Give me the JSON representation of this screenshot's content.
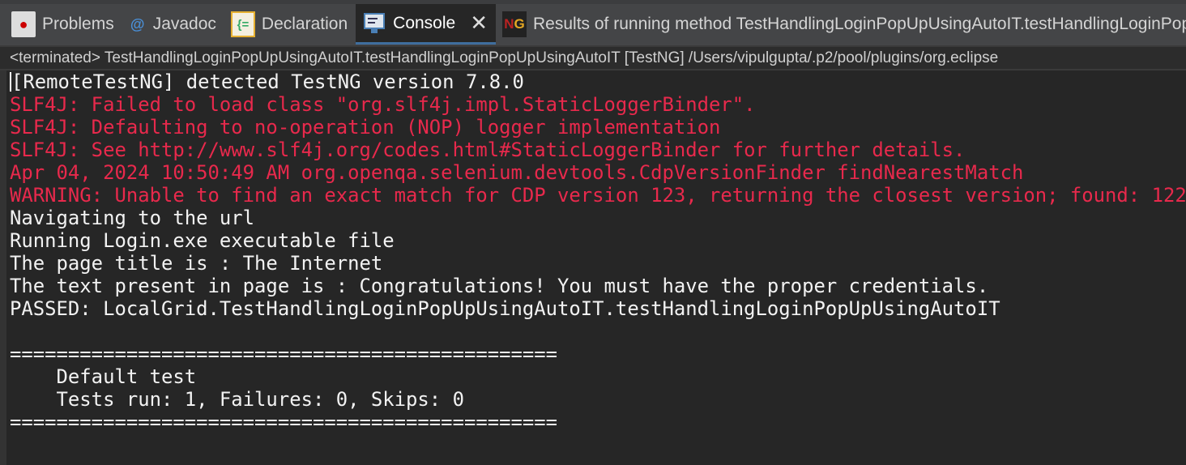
{
  "tabs": [
    {
      "label": "Problems",
      "icon": "problems-icon"
    },
    {
      "label": "Javadoc",
      "icon": "at-icon"
    },
    {
      "label": "Declaration",
      "icon": "declaration-icon"
    },
    {
      "label": "Console",
      "icon": "console-icon",
      "active": true
    },
    {
      "label": "Results of running method TestHandlingLoginPopUpUsingAutoIT.testHandlingLoginPopUpUsingAutoIT",
      "icon": "testng-icon"
    }
  ],
  "status": "<terminated> TestHandlingLoginPopUpUsingAutoIT.testHandlingLoginPopUpUsingAutoIT [TestNG] /Users/vipulgupta/.p2/pool/plugins/org.eclipse",
  "console": {
    "lines": [
      {
        "text": "[RemoteTestNG] detected TestNG version 7.8.0",
        "type": "stdout"
      },
      {
        "text": "SLF4J: Failed to load class \"org.slf4j.impl.StaticLoggerBinder\".",
        "type": "stderr"
      },
      {
        "text": "SLF4J: Defaulting to no-operation (NOP) logger implementation",
        "type": "stderr"
      },
      {
        "text": "SLF4J: See http://www.slf4j.org/codes.html#StaticLoggerBinder for further details.",
        "type": "stderr"
      },
      {
        "text": "Apr 04, 2024 10:50:49 AM org.openqa.selenium.devtools.CdpVersionFinder findNearestMatch",
        "type": "stderr"
      },
      {
        "text": "WARNING: Unable to find an exact match for CDP version 123, returning the closest version; found: 122",
        "type": "stderr"
      },
      {
        "text": "Navigating to the url",
        "type": "stdout"
      },
      {
        "text": "Running Login.exe executable file",
        "type": "stdout"
      },
      {
        "text": "The page title is : The Internet",
        "type": "stdout"
      },
      {
        "text": "The text present in page is : Congratulations! You must have the proper credentials.",
        "type": "stdout"
      },
      {
        "text": "PASSED: LocalGrid.TestHandlingLoginPopUpUsingAutoIT.testHandlingLoginPopUpUsingAutoIT",
        "type": "stdout"
      },
      {
        "text": "",
        "type": "stdout"
      },
      {
        "text": "===============================================",
        "type": "stdout"
      },
      {
        "text": "    Default test",
        "type": "stdout"
      },
      {
        "text": "    Tests run: 1, Failures: 0, Skips: 0",
        "type": "stdout"
      },
      {
        "text": "===============================================",
        "type": "stdout"
      }
    ]
  },
  "colors": {
    "stdout": "#f2f2f2",
    "stderr": "#e8294c",
    "accent": "#3f6e9e"
  }
}
